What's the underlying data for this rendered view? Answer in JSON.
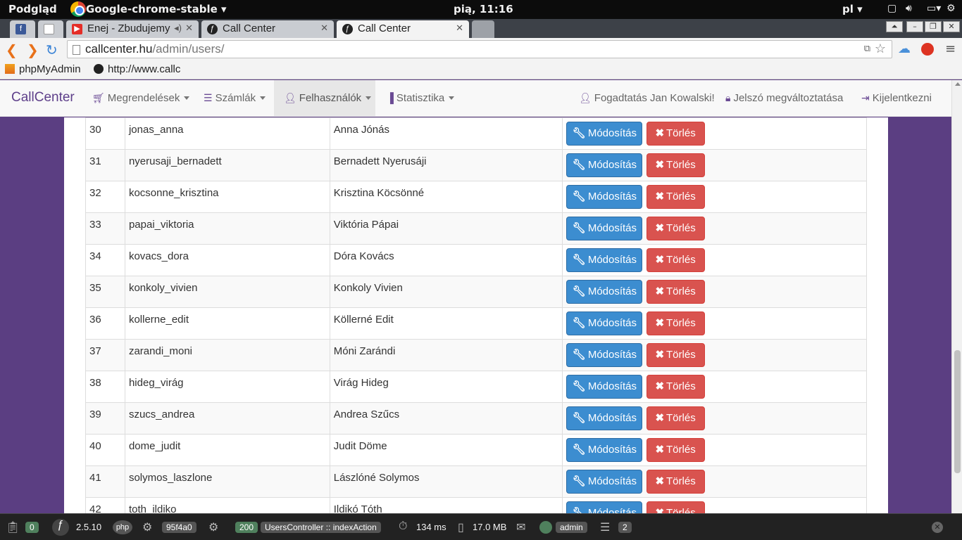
{
  "os": {
    "app_name": "Podgląd",
    "window_title": "Google-chrome-stable",
    "clock": "pią, 11:16",
    "lang": "pl"
  },
  "tabs": [
    {
      "title": "",
      "favicon": "facebook-icon"
    },
    {
      "title": "",
      "favicon": "page-icon"
    },
    {
      "title": "Enej - Zbudujemy",
      "favicon": "youtube-icon"
    },
    {
      "title": "Call Center",
      "favicon": "symfony-icon"
    },
    {
      "title": "Call Center",
      "favicon": "symfony-icon"
    }
  ],
  "address": {
    "host": "callcenter.hu",
    "path": "/admin/users/"
  },
  "bookmarks": [
    {
      "label": "phpMyAdmin"
    },
    {
      "label": "http://www.callc"
    }
  ],
  "navbar": {
    "brand": "CallCenter",
    "menu": [
      {
        "label": "Megrendelések",
        "icon": "cart-icon"
      },
      {
        "label": "Számlák",
        "icon": "list-icon"
      },
      {
        "label": "Felhasználók",
        "icon": "user-icon"
      },
      {
        "label": "Statisztika",
        "icon": "stats-icon"
      }
    ],
    "right": [
      {
        "label": "Fogadtatás Jan Kowalski!",
        "icon": "user-icon"
      },
      {
        "label": "Jelszó megváltoztatása",
        "icon": "lock-icon"
      },
      {
        "label": "Kijelentkezni",
        "icon": "logout-icon"
      }
    ]
  },
  "table": {
    "edit_label": "Módosítás",
    "delete_label": "Törlés",
    "rows": [
      {
        "id": "30",
        "username": "jonas_anna",
        "name": "Anna Jónás"
      },
      {
        "id": "31",
        "username": "nyerusaji_bernadett",
        "name": "Bernadett Nyerusáji"
      },
      {
        "id": "32",
        "username": "kocsonne_krisztina",
        "name": "Krisztina Köcsönné"
      },
      {
        "id": "33",
        "username": "papai_viktoria",
        "name": "Viktória Pápai"
      },
      {
        "id": "34",
        "username": "kovacs_dora",
        "name": "Dóra Kovács"
      },
      {
        "id": "35",
        "username": "konkoly_vivien",
        "name": "Konkoly Vivien"
      },
      {
        "id": "36",
        "username": "kollerne_edit",
        "name": "Köllerné Edit"
      },
      {
        "id": "37",
        "username": "zarandi_moni",
        "name": "Móni Zarándi"
      },
      {
        "id": "38",
        "username": "hideg_virág",
        "name": "Virág Hideg"
      },
      {
        "id": "39",
        "username": "szucs_andrea",
        "name": "Andrea Szűcs"
      },
      {
        "id": "40",
        "username": "dome_judit",
        "name": "Judit Döme"
      },
      {
        "id": "41",
        "username": "solymos_laszlone",
        "name": "Lászlóné Solymos"
      },
      {
        "id": "42",
        "username": "toth_ildiko",
        "name": "Ildikó Tóth"
      }
    ]
  },
  "debugbar": {
    "requests": "0",
    "sf_version": "2.5.10",
    "token": "95f4a0",
    "status": "200",
    "controller": "UsersController",
    "action": "indexAction",
    "time": "134 ms",
    "memory": "17.0 MB",
    "user": "admin",
    "queries": "2"
  }
}
